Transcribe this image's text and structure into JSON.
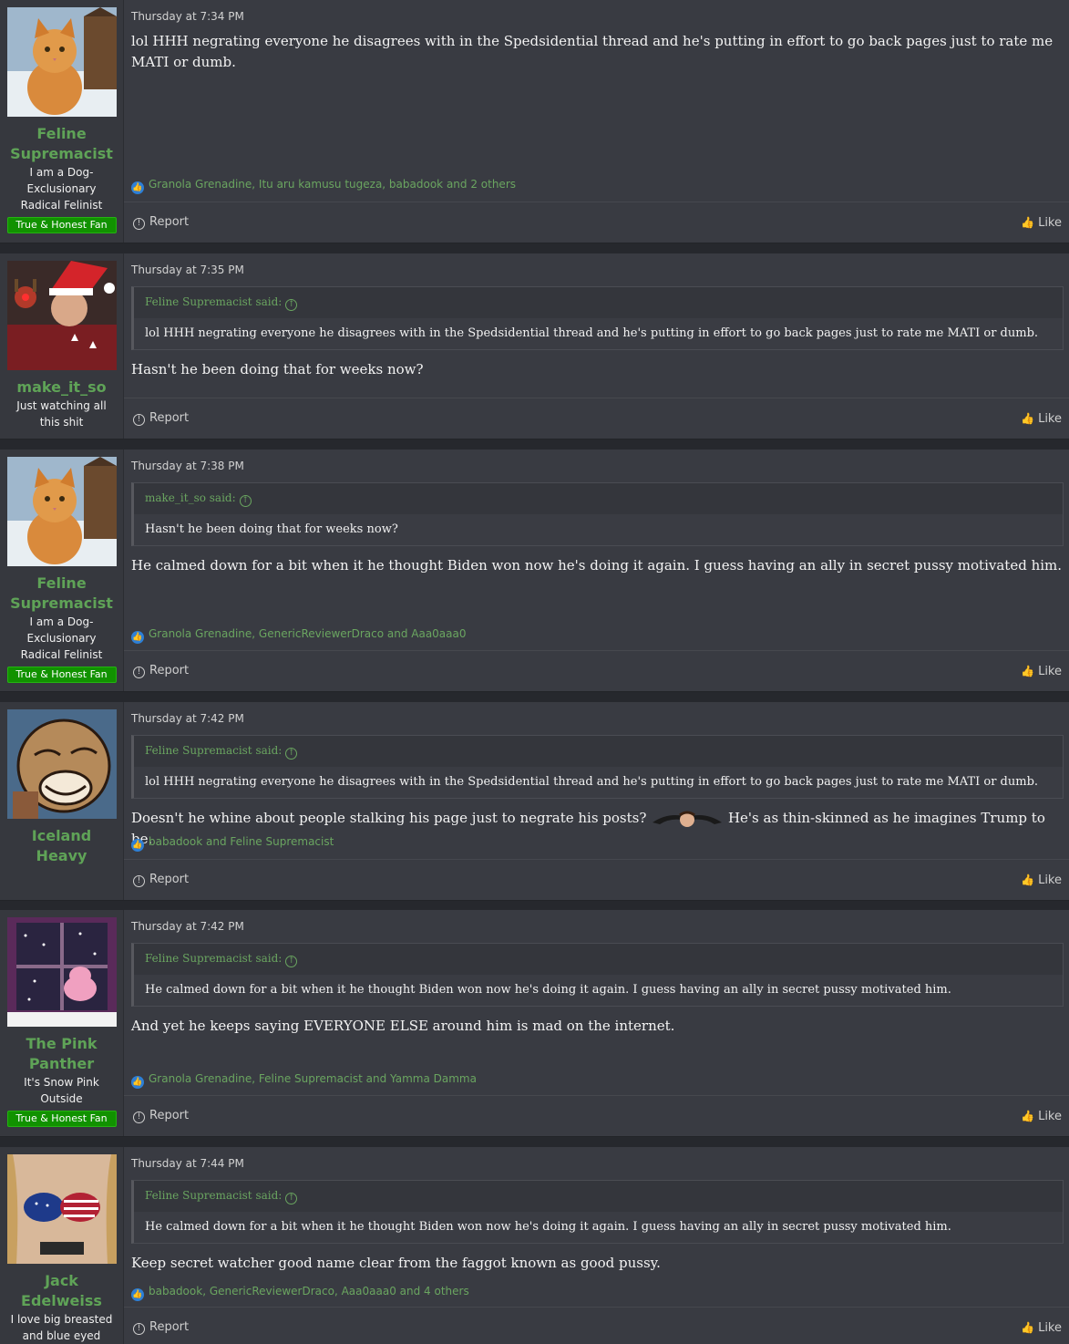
{
  "posts": [
    {
      "username": "Feline Supremacist",
      "user_title": "I am a Dog-Exclusionary Radical Felinist",
      "banner": "True & Honest Fan",
      "time": "Thursday at 7:34 PM",
      "text": "lol HHH negrating everyone he disagrees with in the Spedsidential thread and he's putting in effort to go back pages just to rate me MATI or dumb.",
      "reactions": "Granola Grenadine, Itu aru kamusu tugeza, babadook and 2 others",
      "report_label": "Report",
      "like_label": "Like",
      "avatar_icon": "cat-avatar-icon"
    },
    {
      "username": "make_it_so",
      "user_title": "Just watching all this shit",
      "time": "Thursday at 7:35 PM",
      "quote_author": "Feline Supremacist said:",
      "quote_text": "lol HHH negrating everyone he disagrees with in the Spedsidential thread and he's putting in effort to go back pages just to rate me MATI or dumb.",
      "text": "Hasn't he been doing that for weeks now?",
      "report_label": "Report",
      "like_label": "Like",
      "avatar_icon": "santa-hat-avatar-icon"
    },
    {
      "username": "Feline Supremacist",
      "user_title": "I am a Dog-Exclusionary Radical Felinist",
      "banner": "True & Honest Fan",
      "time": "Thursday at 7:38 PM",
      "quote_author": "make_it_so said:",
      "quote_text": "Hasn't he been doing that for weeks now?",
      "text": "He calmed down for a bit when it he thought Biden won now he's doing it again. I guess having an ally in secret pussy motivated him.",
      "reactions": "Granola Grenadine, GenericReviewerDraco and Aaa0aaa0",
      "report_label": "Report",
      "like_label": "Like",
      "avatar_icon": "cat-avatar-icon"
    },
    {
      "username": "Iceland Heavy",
      "time": "Thursday at 7:42 PM",
      "quote_author": "Feline Supremacist said:",
      "quote_text": "lol HHH negrating everyone he disagrees with in the Spedsidential thread and he's putting in effort to go back pages just to rate me MATI or dumb.",
      "text_before": "Doesn't he whine about people stalking his page just to negrate his posts?",
      "text_after": "He's as thin-skinned as he imagines Trump to be.",
      "reactions": "babadook and Feline Supremacist",
      "report_label": "Report",
      "like_label": "Like",
      "avatar_icon": "cartoon-dog-avatar-icon"
    },
    {
      "username": "The Pink Panther",
      "user_title": "It's Snow Pink Outside",
      "banner": "True & Honest Fan",
      "time": "Thursday at 7:42 PM",
      "quote_author": "Feline Supremacist said:",
      "quote_text": "He calmed down for a bit when it he thought Biden won now he's doing it again. I guess having an ally in secret pussy motivated him.",
      "text": "And yet he keeps saying EVERYONE ELSE around him is mad on the internet.",
      "reactions": "Granola Grenadine, Feline Supremacist and Yamma Damma",
      "report_label": "Report",
      "like_label": "Like",
      "avatar_icon": "pink-panther-avatar-icon"
    },
    {
      "username": "Jack Edelweiss",
      "user_title": "I love big breasted and blue eyed blonde and MAGA",
      "time": "Thursday at 7:44 PM",
      "quote_author": "Feline Supremacist said:",
      "quote_text": "He calmed down for a bit when it he thought Biden won now he's doing it again. I guess having an ally in secret pussy motivated him.",
      "text": "Keep secret watcher good name clear from the faggot known as good pussy.",
      "reactions": "babadook, GenericReviewerDraco, Aaa0aaa0 and 4 others",
      "report_label": "Report",
      "like_label": "Like",
      "avatar_icon": "flag-bikini-avatar-icon"
    }
  ]
}
